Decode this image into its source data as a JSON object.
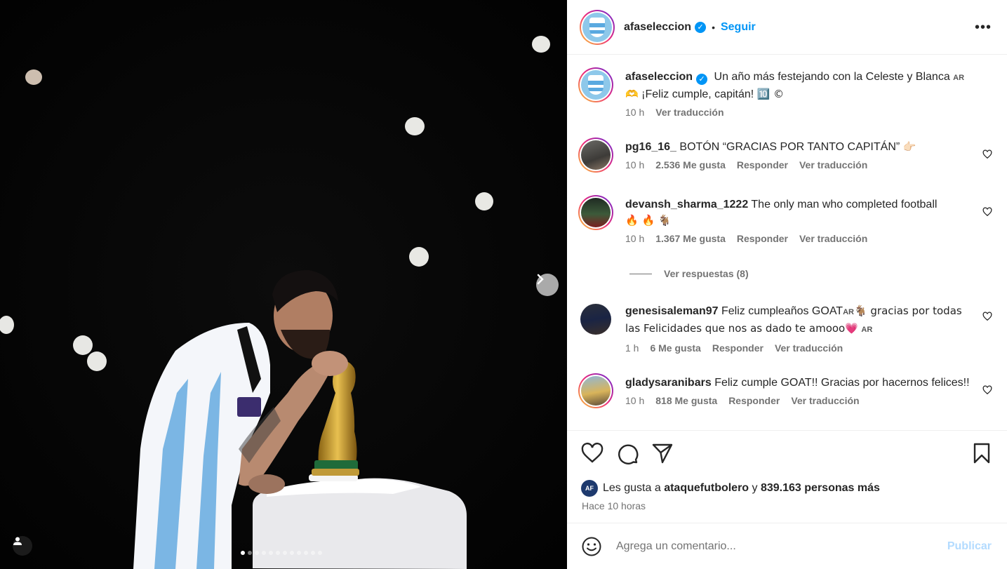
{
  "post": {
    "username": "afaseleccion",
    "separator": "•",
    "follow_label": "Seguir",
    "more_label": "•••",
    "verified_mark": "✓"
  },
  "caption": {
    "username": "afaseleccion",
    "text_line1": "Un año más festejando con la Celeste y Blanca",
    "flag": "AR",
    "text_line2_emoji": "🫶",
    "text_line2": "¡Feliz cumple, capitán!",
    "text_line2_tail": "🔟 ©",
    "time": "10 h",
    "translate_label": "Ver traducción"
  },
  "comments": [
    {
      "username": "pg16_16_",
      "text": "BOTÓN “GRACIAS POR TANTO CAPITÁN”",
      "emoji": "👉🏻",
      "time": "10 h",
      "likes": "2.536 Me gusta",
      "reply_label": "Responder",
      "translate_label": "Ver traducción"
    },
    {
      "username": "devansh_sharma_1222",
      "text": "The only man who completed football",
      "emoji": "🔥 🔥 🐐",
      "time": "10 h",
      "likes": "1.367 Me gusta",
      "reply_label": "Responder",
      "translate_label": "Ver traducción"
    },
    {
      "username": "genesisaleman97",
      "text": "Feliz cumpleaños GOAT",
      "flag": "AR",
      "text_part2": "🐐 gracias por todas las Felicidades que nos as dado te amooo",
      "emoji_end": "💗",
      "flag_end": "AR",
      "time": "1 h",
      "likes": "6 Me gusta",
      "reply_label": "Responder",
      "translate_label": "Ver traducción"
    },
    {
      "username": "gladysaranibars",
      "text": "Feliz cumple GOAT!! Gracias por hacernos felices!!",
      "time": "10 h",
      "likes": "818 Me gusta",
      "reply_label": "Responder",
      "translate_label": "Ver traducción"
    }
  ],
  "replies_label": "Ver respuestas (8)",
  "likes_summary": {
    "prefix": "Les gusta a",
    "user": "ataquefutbolero",
    "connector": "y",
    "others": "839.163 personas más",
    "avatar_text": "AF"
  },
  "posted_ago": "Hace 10 horas",
  "composer": {
    "placeholder": "Agrega un comentario...",
    "post_label": "Publicar"
  },
  "carousel": {
    "total_slides": 12,
    "active_index": 0
  },
  "colors": {
    "accent": "#0095f6",
    "muted": "#737373",
    "post_disabled": "#b3dbff"
  }
}
